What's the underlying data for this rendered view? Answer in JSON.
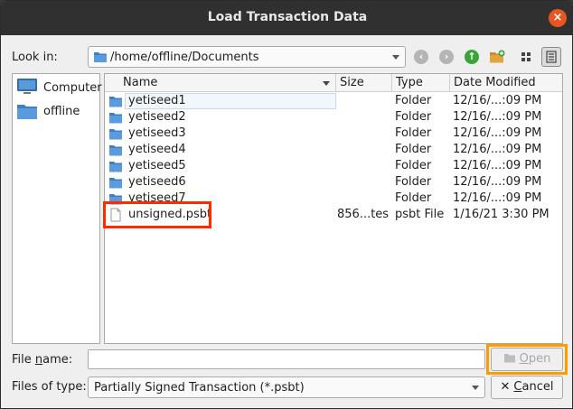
{
  "window": {
    "title": "Load Transaction Data",
    "close_glyph": "×"
  },
  "lookin": {
    "label": "Look in:",
    "path": "/home/offline/Documents",
    "icons": [
      "back-icon",
      "forward-icon",
      "parent-dir-icon",
      "new-folder-icon",
      "list-view-icon",
      "detail-view-icon"
    ]
  },
  "sidebar": {
    "items": [
      {
        "label": "Computer",
        "icon": "computer-icon"
      },
      {
        "label": "offline",
        "icon": "folder-icon"
      }
    ]
  },
  "columns": {
    "name": "Name",
    "size": "Size",
    "type": "Type",
    "date": "Date Modified"
  },
  "files": [
    {
      "name": "yetiseed1",
      "size": "",
      "type": "Folder",
      "date": "12/16/...:09 PM",
      "icon": "folder-icon"
    },
    {
      "name": "yetiseed2",
      "size": "",
      "type": "Folder",
      "date": "12/16/...:09 PM",
      "icon": "folder-icon"
    },
    {
      "name": "yetiseed3",
      "size": "",
      "type": "Folder",
      "date": "12/16/...:09 PM",
      "icon": "folder-icon"
    },
    {
      "name": "yetiseed4",
      "size": "",
      "type": "Folder",
      "date": "12/16/...:09 PM",
      "icon": "folder-icon"
    },
    {
      "name": "yetiseed5",
      "size": "",
      "type": "Folder",
      "date": "12/16/...:09 PM",
      "icon": "folder-icon"
    },
    {
      "name": "yetiseed6",
      "size": "",
      "type": "Folder",
      "date": "12/16/...:09 PM",
      "icon": "folder-icon"
    },
    {
      "name": "yetiseed7",
      "size": "",
      "type": "Folder",
      "date": "12/16/...:09 PM",
      "icon": "folder-icon"
    },
    {
      "name": "unsigned.psbt",
      "size": "856...tes",
      "type": "psbt File",
      "date": "1/16/21 3:30 PM",
      "icon": "file-icon"
    }
  ],
  "filename": {
    "label_pre": "File ",
    "label_key": "n",
    "label_post": "ame:",
    "value": ""
  },
  "filetype": {
    "label": "Files of type:",
    "value": "Partially Signed Transaction (*.psbt)"
  },
  "buttons": {
    "open": {
      "label_pre": "",
      "label_key": "O",
      "label_post": "pen",
      "enabled": false
    },
    "cancel": {
      "label_pre": "",
      "label_key": "C",
      "label_post": "ancel",
      "glyph": "✕"
    }
  },
  "colors": {
    "folder": "#3d7fc4",
    "highlight_red": "#ff2a00",
    "highlight_orange": "#ff9a00",
    "titlebar": "#303030",
    "close": "#e95420"
  }
}
